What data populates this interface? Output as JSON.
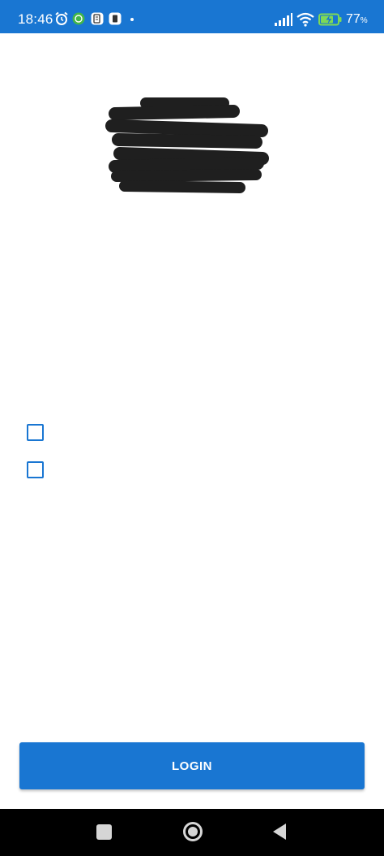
{
  "status_bar": {
    "time": "18:46",
    "battery_percent": "77",
    "battery_unit": "%",
    "icons": [
      "alarm-icon",
      "app-notification-icon",
      "app-notification-icon",
      "app-notification-icon",
      "signal-icon",
      "wifi-icon",
      "battery-charging-icon"
    ]
  },
  "header": {
    "logo": "redacted-logo"
  },
  "form": {
    "checkboxes": [
      {
        "checked": false
      },
      {
        "checked": false
      }
    ],
    "login_label": "LOGIN"
  },
  "nav_bar": {
    "icons": [
      "recents-icon",
      "home-icon",
      "back-icon"
    ]
  },
  "colors": {
    "primary": "#1976d2",
    "background": "#ffffff",
    "nav_bar": "#000000"
  }
}
